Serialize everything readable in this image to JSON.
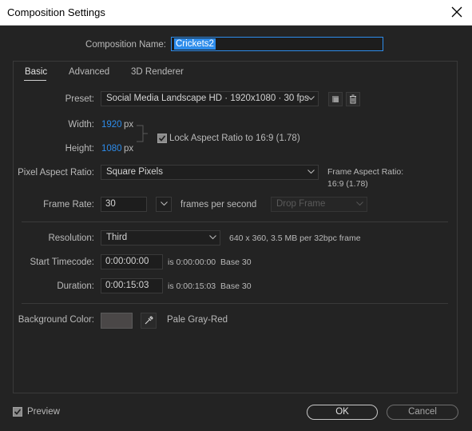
{
  "window": {
    "title": "Composition Settings"
  },
  "composition_name": {
    "label": "Composition Name:",
    "value": "Crickets2"
  },
  "tabs": [
    {
      "label": "Basic",
      "active": true
    },
    {
      "label": "Advanced",
      "active": false
    },
    {
      "label": "3D Renderer",
      "active": false
    }
  ],
  "preset": {
    "label": "Preset:",
    "value": "Social Media Landscape HD  ·  1920x1080 · 30 fps"
  },
  "size": {
    "width_label": "Width:",
    "width_value": "1920",
    "width_unit": "px",
    "height_label": "Height:",
    "height_value": "1080",
    "height_unit": "px",
    "lock_label": "Lock Aspect Ratio to 16:9 (1.78)",
    "lock_checked": true
  },
  "pixel_aspect": {
    "label": "Pixel Aspect Ratio:",
    "value": "Square Pixels",
    "frame_aspect_label": "Frame Aspect Ratio:",
    "frame_aspect_value": "16:9 (1.78)"
  },
  "frame_rate": {
    "label": "Frame Rate:",
    "value": "30",
    "unit": "frames per second",
    "drop_frame": "Drop Frame"
  },
  "resolution": {
    "label": "Resolution:",
    "value": "Third",
    "info": "640 x 360, 3.5 MB per 32bpc frame"
  },
  "start_timecode": {
    "label": "Start Timecode:",
    "value": "0:00:00:00",
    "is_text": "is 0:00:00:00",
    "base": "Base 30"
  },
  "duration": {
    "label": "Duration:",
    "value": "0:00:15:03",
    "is_text": "is 0:00:15:03",
    "base": "Base 30"
  },
  "background": {
    "label": "Background Color:",
    "color_name": "Pale Gray-Red",
    "swatch_color": "#4a4747"
  },
  "footer": {
    "preview_label": "Preview",
    "preview_checked": true,
    "ok_label": "OK",
    "cancel_label": "Cancel"
  },
  "colors": {
    "accent": "#2d8ceb",
    "background": "#232323"
  }
}
